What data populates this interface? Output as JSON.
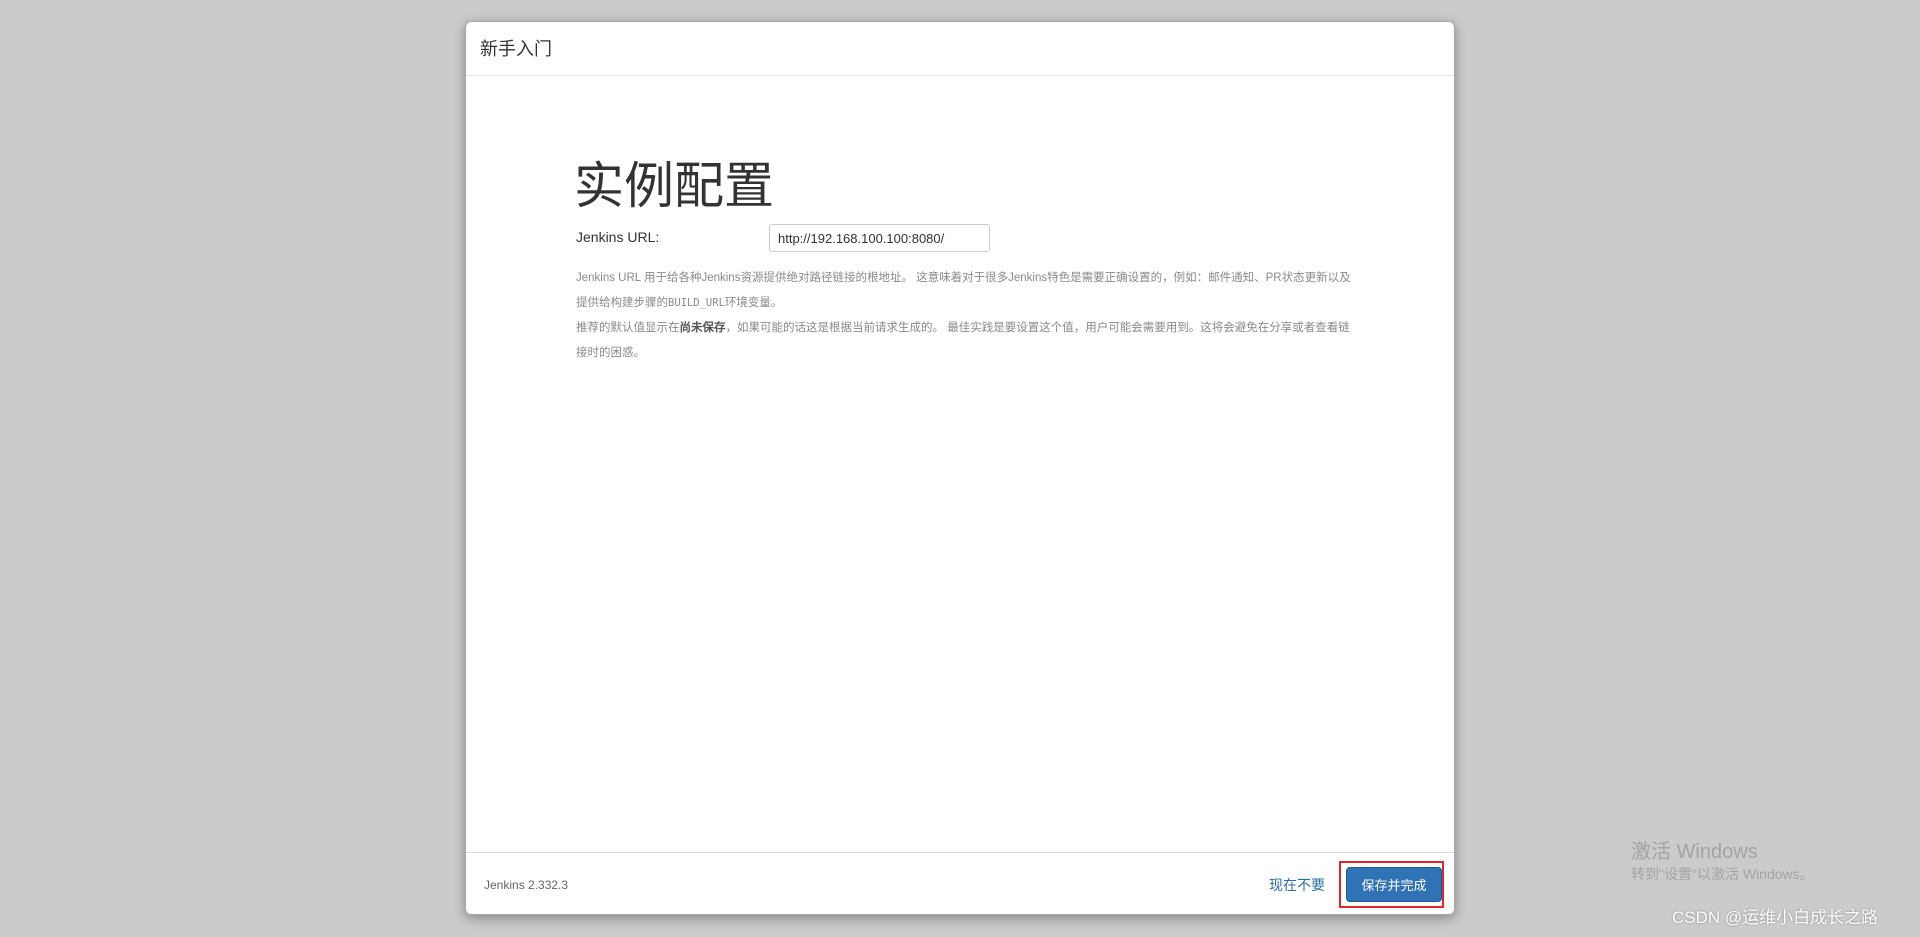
{
  "dialog": {
    "title": "新手入门",
    "heading": "实例配置",
    "url_label": "Jenkins URL:",
    "url_value": "http://192.168.100.100:8080/",
    "help": {
      "p1_a": "Jenkins URL 用于给各种Jenkins资源提供绝对路径链接的根地址。 这意味着对于很多Jenkins特色是需要正确设置的，例如：邮件通知、PR状态更新以及提供给构建步骤的",
      "p1_code": "BUILD_URL",
      "p1_b": "环境变量。",
      "p2_a": "推荐的默认值显示在",
      "p2_strong": "尚未保存",
      "p2_b": "，如果可能的话这是根据当前请求生成的。 最佳实践是要设置这个值，用户可能会需要用到。这将会避免在分享或者查看链接时的困惑。"
    }
  },
  "footer": {
    "version": "Jenkins 2.332.3",
    "skip_label": "现在不要",
    "save_label": "保存并完成"
  },
  "watermark": {
    "title": "激活 Windows",
    "subtitle": "转到\"设置\"以激活 Windows。"
  },
  "credit": "CSDN @运维小白成长之路"
}
